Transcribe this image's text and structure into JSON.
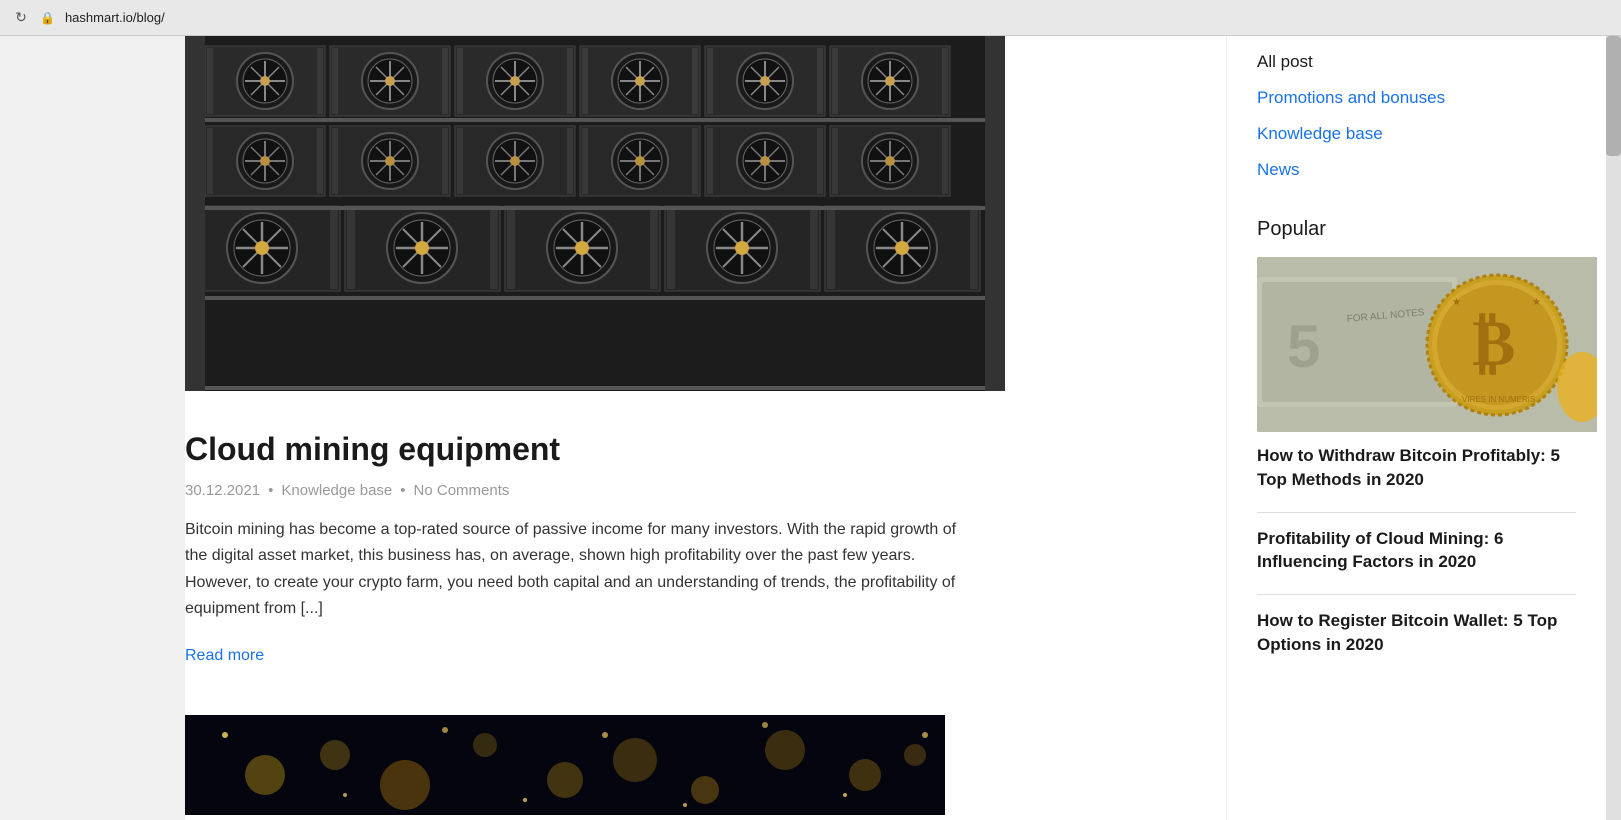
{
  "browser": {
    "url": "hashmart.io/blog/",
    "refresh_icon": "↻",
    "lock_icon": "🔒"
  },
  "sidebar_nav": {
    "all_post_label": "All post",
    "promotions_label": "Promotions and bonuses",
    "knowledge_base_label": "Knowledge base",
    "news_label": "News"
  },
  "popular_section": {
    "title": "Popular",
    "articles": [
      {
        "title": "How to Withdraw Bitcoin Profitably: 5 Top Methods in 2020"
      },
      {
        "title": "Profitability of Cloud Mining: 6 Influencing Factors in 2020"
      },
      {
        "title": "How to Register Bitcoin Wallet: 5 Top Options in 2020"
      }
    ]
  },
  "main_article": {
    "title": "Cloud mining equipment",
    "date": "30.12.2021",
    "category": "Knowledge base",
    "comments": "No Comments",
    "excerpt": "Bitcoin mining has become a top-rated source of passive income for many investors. With the rapid growth of the digital asset market, this business has, on average, shown high profitability over the past few years. However, to create your crypto farm, you need both capital and an understanding of trends, the profitability of equipment from [...]",
    "read_more_label": "Read more"
  }
}
